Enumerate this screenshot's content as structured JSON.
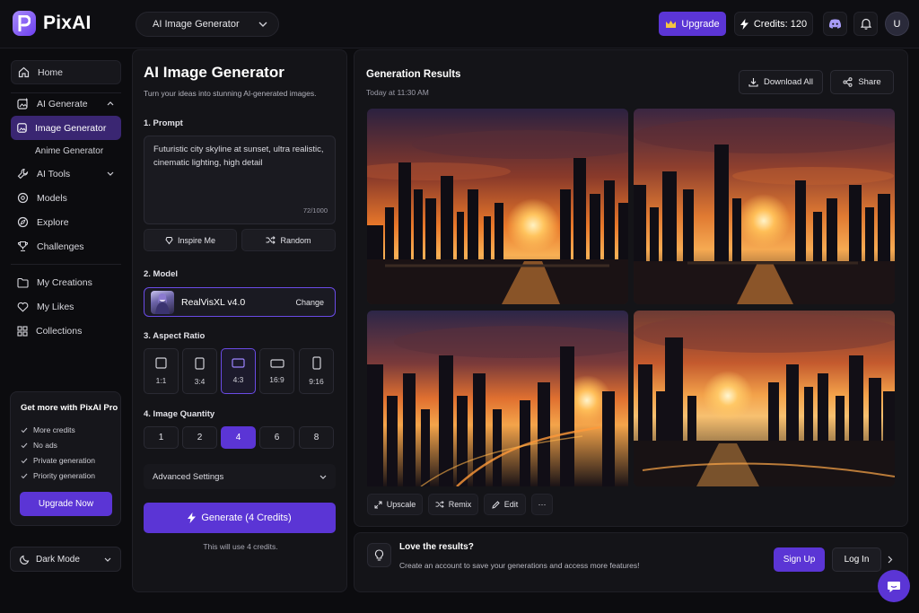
{
  "app": {
    "name": "PixAI"
  },
  "header": {
    "model_select": "AI Image Generator",
    "upgrade_label": "Upgrade",
    "credits_label": "Credits: 120",
    "avatar_initial": "U"
  },
  "sidebar": {
    "home": "Home",
    "ai_generate": "AI Generate",
    "image_generator": "Image Generator",
    "anime_generator": "Anime Generator",
    "ai_tools": "AI Tools",
    "models": "Models",
    "explore": "Explore",
    "challenges": "Challenges",
    "my_creations": "My Creations",
    "my_likes": "My Likes",
    "collections": "Collections",
    "promo": {
      "title": "Get more with PixAI Pro",
      "items": [
        "More credits",
        "No ads",
        "Private generation",
        "Priority generation"
      ],
      "button": "Upgrade Now"
    },
    "dark_mode": "Dark Mode"
  },
  "form": {
    "title": "AI Image Generator",
    "subtitle": "Turn your ideas into stunning AI-generated images.",
    "prompt_label": "1. Prompt",
    "prompt_value": "Futuristic city skyline at sunset, ultra realistic, cinematic lighting, high detail",
    "prompt_counter": "72/1000",
    "inspire_label": "Inspire Me",
    "random_label": "Random",
    "model_label": "2. Model",
    "model_name": "RealVisXL v4.0",
    "change_label": "Change",
    "aspect_label": "3. Aspect Ratio",
    "aspect_options": [
      "1:1",
      "3:4",
      "4:3",
      "16:9",
      "9:16"
    ],
    "aspect_selected": "4:3",
    "quantity_label": "4. Image Quantity",
    "quantity_options": [
      "1",
      "2",
      "4",
      "6",
      "8"
    ],
    "quantity_selected": "4",
    "advanced_label": "Advanced Settings",
    "generate_label": "Generate (4 Credits)",
    "generate_note": "This will use 4 credits."
  },
  "results": {
    "title": "Generation Results",
    "timestamp": "Today at 11:30 AM",
    "download_label": "Download All",
    "share_label": "Share",
    "actions": {
      "upscale": "Upscale",
      "remix": "Remix",
      "edit": "Edit",
      "more": "···"
    }
  },
  "banner": {
    "title": "Love the results?",
    "text": "Create an account to save your generations and access more features!",
    "signup": "Sign Up",
    "login": "Log In"
  },
  "colors": {
    "accent": "#5b35d5",
    "background": "#0c0c0f",
    "panel": "#141418"
  }
}
